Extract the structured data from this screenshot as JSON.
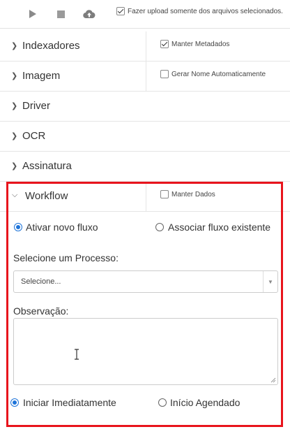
{
  "toolbar": {
    "upload_only_selected_label": "Fazer upload somente dos arquivos selecionados.",
    "upload_only_selected_checked": true,
    "icons": [
      "play-icon",
      "stop-icon",
      "cloud-upload-icon"
    ]
  },
  "sections": [
    {
      "title": "Indexadores",
      "option_label": "Manter Metadados",
      "option_checked": true,
      "expanded": false
    },
    {
      "title": "Imagem",
      "option_label": "Gerar Nome Automaticamente",
      "option_checked": false,
      "expanded": false
    },
    {
      "title": "Driver",
      "expanded": false
    },
    {
      "title": "OCR",
      "expanded": false
    },
    {
      "title": "Assinatura",
      "expanded": false
    },
    {
      "title": "Workflow",
      "option_label": "Manter Dados",
      "option_checked": false,
      "expanded": true
    }
  ],
  "workflow": {
    "flow_mode": {
      "options": [
        "Ativar novo fluxo",
        "Associar fluxo existente"
      ],
      "selected": "Ativar novo fluxo"
    },
    "process_label": "Selecione um Processo:",
    "process_select_value": "Selecione...",
    "observation_label": "Observação:",
    "observation_value": "",
    "start_mode": {
      "options": [
        "Iniciar Imediatamente",
        "Início Agendado"
      ],
      "selected": "Iniciar Imediatamente"
    }
  },
  "colors": {
    "highlight_border": "#e8141c",
    "radio_selected": "#1e74d9"
  }
}
